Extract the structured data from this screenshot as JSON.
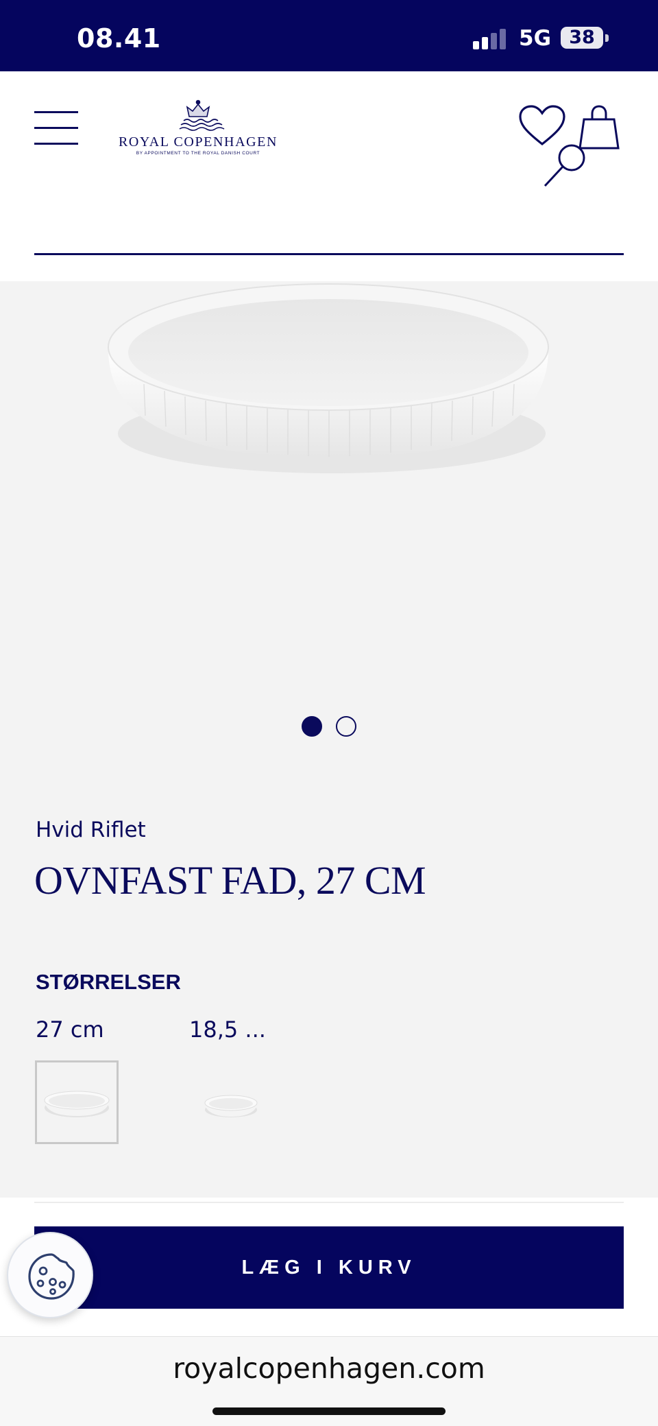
{
  "status_bar": {
    "time": "08.41",
    "network": "5G",
    "battery": "38"
  },
  "header": {
    "brand_name": "ROYAL COPENHAGEN",
    "brand_tagline": "BY APPOINTMENT TO THE ROYAL DANISH COURT",
    "icons": [
      "menu-icon",
      "crown-logo-icon",
      "heart-icon",
      "shopping-bag-icon",
      "search-icon"
    ]
  },
  "search": {
    "value": "",
    "placeholder": ""
  },
  "gallery": {
    "image_count": 2,
    "active_index": 0
  },
  "product": {
    "series": "Hvid Riflet",
    "title": "OVNFAST FAD, 27 CM"
  },
  "sizes": {
    "heading": "STØRRELSER",
    "options": [
      {
        "label": "27 cm",
        "selected": true
      },
      {
        "label": "18,5 ...",
        "selected": false
      }
    ]
  },
  "actions": {
    "add_to_cart": "LÆG I KURV",
    "cookie_icon": "cookie-icon"
  },
  "browser": {
    "url": "royalcopenhagen.com"
  },
  "colors": {
    "navy": "#05055e",
    "text_navy": "#0a0a5c",
    "product_bg": "#f3f3f3",
    "white": "#ffffff"
  }
}
